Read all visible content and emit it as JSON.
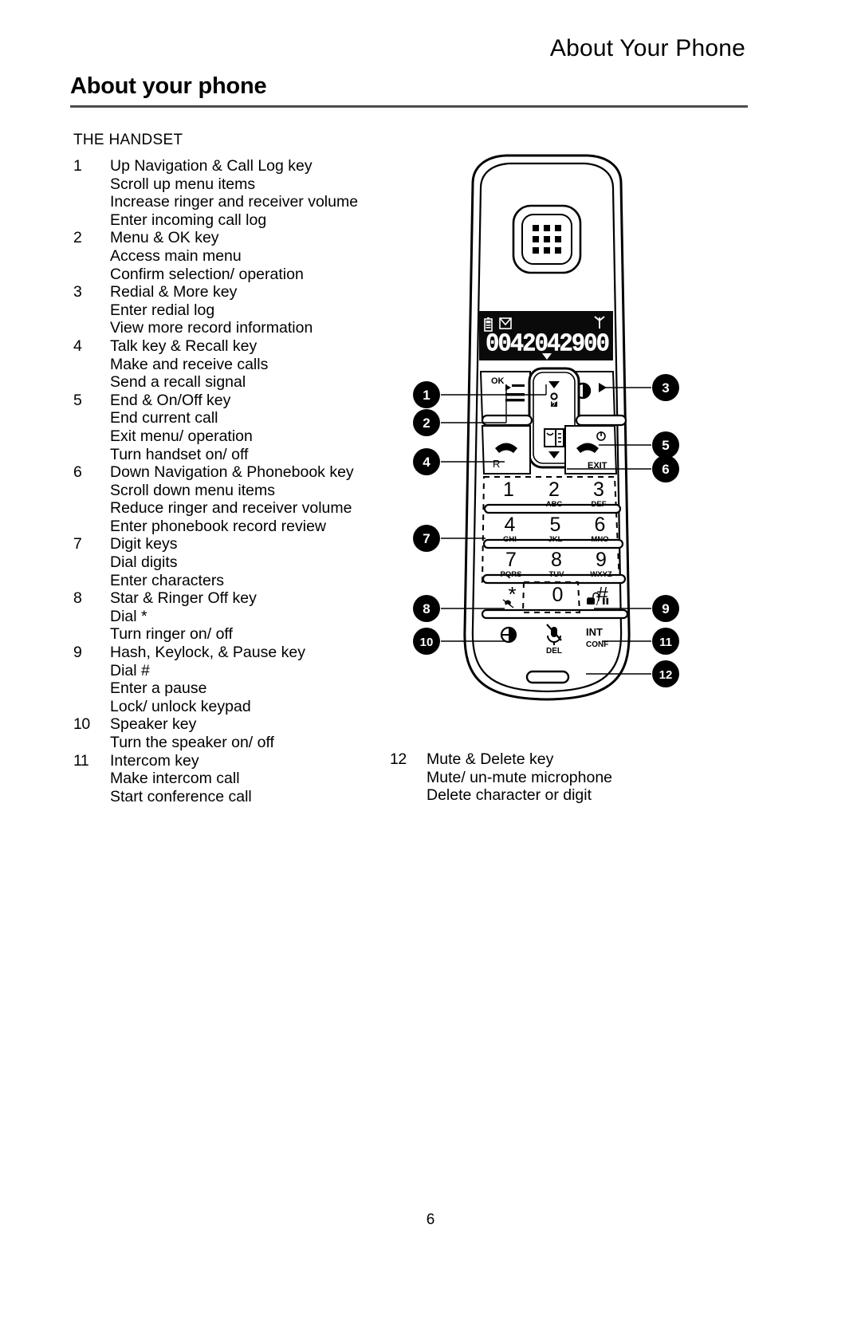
{
  "header": {
    "running_head": "About Your Phone",
    "chapter_title": "About your phone"
  },
  "section": {
    "label": "THE HANDSET"
  },
  "entries_left": [
    {
      "num": "1",
      "title": "Up Navigation & Call Log key",
      "subs": [
        "Scroll up menu items",
        "Increase ringer and receiver volume",
        "Enter incoming call log"
      ]
    },
    {
      "num": "2",
      "title": "Menu & OK key",
      "subs": [
        "Access main menu",
        "Confirm selection/ operation"
      ]
    },
    {
      "num": "3",
      "title": "Redial & More key",
      "subs": [
        "Enter redial log",
        "View more record information"
      ]
    },
    {
      "num": "4",
      "title": "Talk key & Recall key",
      "subs": [
        "Make and receive calls",
        "Send a recall signal"
      ]
    },
    {
      "num": "5",
      "title": "End & On/Off key",
      "subs": [
        "End current call",
        "Exit menu/ operation",
        "Turn handset on/ off"
      ]
    },
    {
      "num": "6",
      "title": "Down Navigation & Phonebook key",
      "subs": [
        "Scroll down menu items",
        "Reduce ringer and receiver volume",
        "Enter phonebook record review"
      ]
    },
    {
      "num": "7",
      "title": "Digit keys",
      "subs": [
        "Dial digits",
        "Enter characters"
      ]
    },
    {
      "num": "8",
      "title": "Star & Ringer Off key",
      "subs": [
        "Dial *",
        "Turn ringer on/ off"
      ]
    },
    {
      "num": "9",
      "title": "Hash, Keylock, & Pause key",
      "subs": [
        "Dial #",
        "Enter a pause",
        "Lock/ unlock keypad"
      ]
    },
    {
      "num": "10",
      "title": "Speaker key",
      "subs": [
        "Turn the speaker on/ off"
      ]
    },
    {
      "num": "11",
      "title": "Intercom key",
      "subs": [
        "Make intercom call",
        "Start conference call"
      ]
    }
  ],
  "entries_right": [
    {
      "num": "12",
      "title": "Mute & Delete key",
      "subs": [
        "Mute/ un-mute microphone",
        "Delete character or digit"
      ]
    }
  ],
  "handset": {
    "display": {
      "digits": "0042042900",
      "battery_icon": "battery-icon",
      "voicemail_icon": "envelope-icon",
      "antenna_icon": "antenna-icon",
      "down_marker_icon": "down-triangle-icon"
    },
    "keys": {
      "ok_label": "OK",
      "menu_icon": "menu-lines-icon",
      "up_arrow_icon": "up-arrow-icon",
      "call_log_icon": "call-log-icon",
      "phonebook_icon": "phonebook-icon",
      "down_arrow_icon": "down-arrow-icon",
      "redial_icon": "redial-icon",
      "right_arrow_icon": "right-arrow-icon",
      "talk_icon": "talk-handset-icon",
      "recall_label": "R",
      "end_icon": "end-handset-icon",
      "power_icon": "power-icon",
      "exit_label": "EXIT",
      "speaker_icon": "speaker-icon",
      "mute_icon": "mute-microphone-icon",
      "delete_label": "DEL",
      "intercom_label_1": "INT",
      "intercom_label_2": "CONF",
      "keylock_icon": "padlock-pause-icon"
    },
    "keypad": [
      {
        "digit": "1",
        "letters": ""
      },
      {
        "digit": "2",
        "letters": "ABC"
      },
      {
        "digit": "3",
        "letters": "DEF"
      },
      {
        "digit": "4",
        "letters": "GHI"
      },
      {
        "digit": "5",
        "letters": "JKL"
      },
      {
        "digit": "6",
        "letters": "MNO"
      },
      {
        "digit": "7",
        "letters": "PQRS"
      },
      {
        "digit": "8",
        "letters": "TUV"
      },
      {
        "digit": "9",
        "letters": "WXYZ"
      },
      {
        "digit": "*",
        "letters": ""
      },
      {
        "digit": "0",
        "letters": ""
      },
      {
        "digit": "#",
        "letters": ""
      }
    ],
    "callouts_left": [
      "1",
      "2",
      "4",
      "7",
      "8",
      "10"
    ],
    "callouts_right": [
      "3",
      "5",
      "6",
      "9",
      "11",
      "12"
    ]
  },
  "footer": {
    "page_number": "6"
  },
  "colors": {
    "ink": "#000000",
    "rule": "#4d4d4d",
    "paper": "#ffffff",
    "lcd_bg": "#0a0a0a",
    "lcd_fg": "#ffffff"
  }
}
